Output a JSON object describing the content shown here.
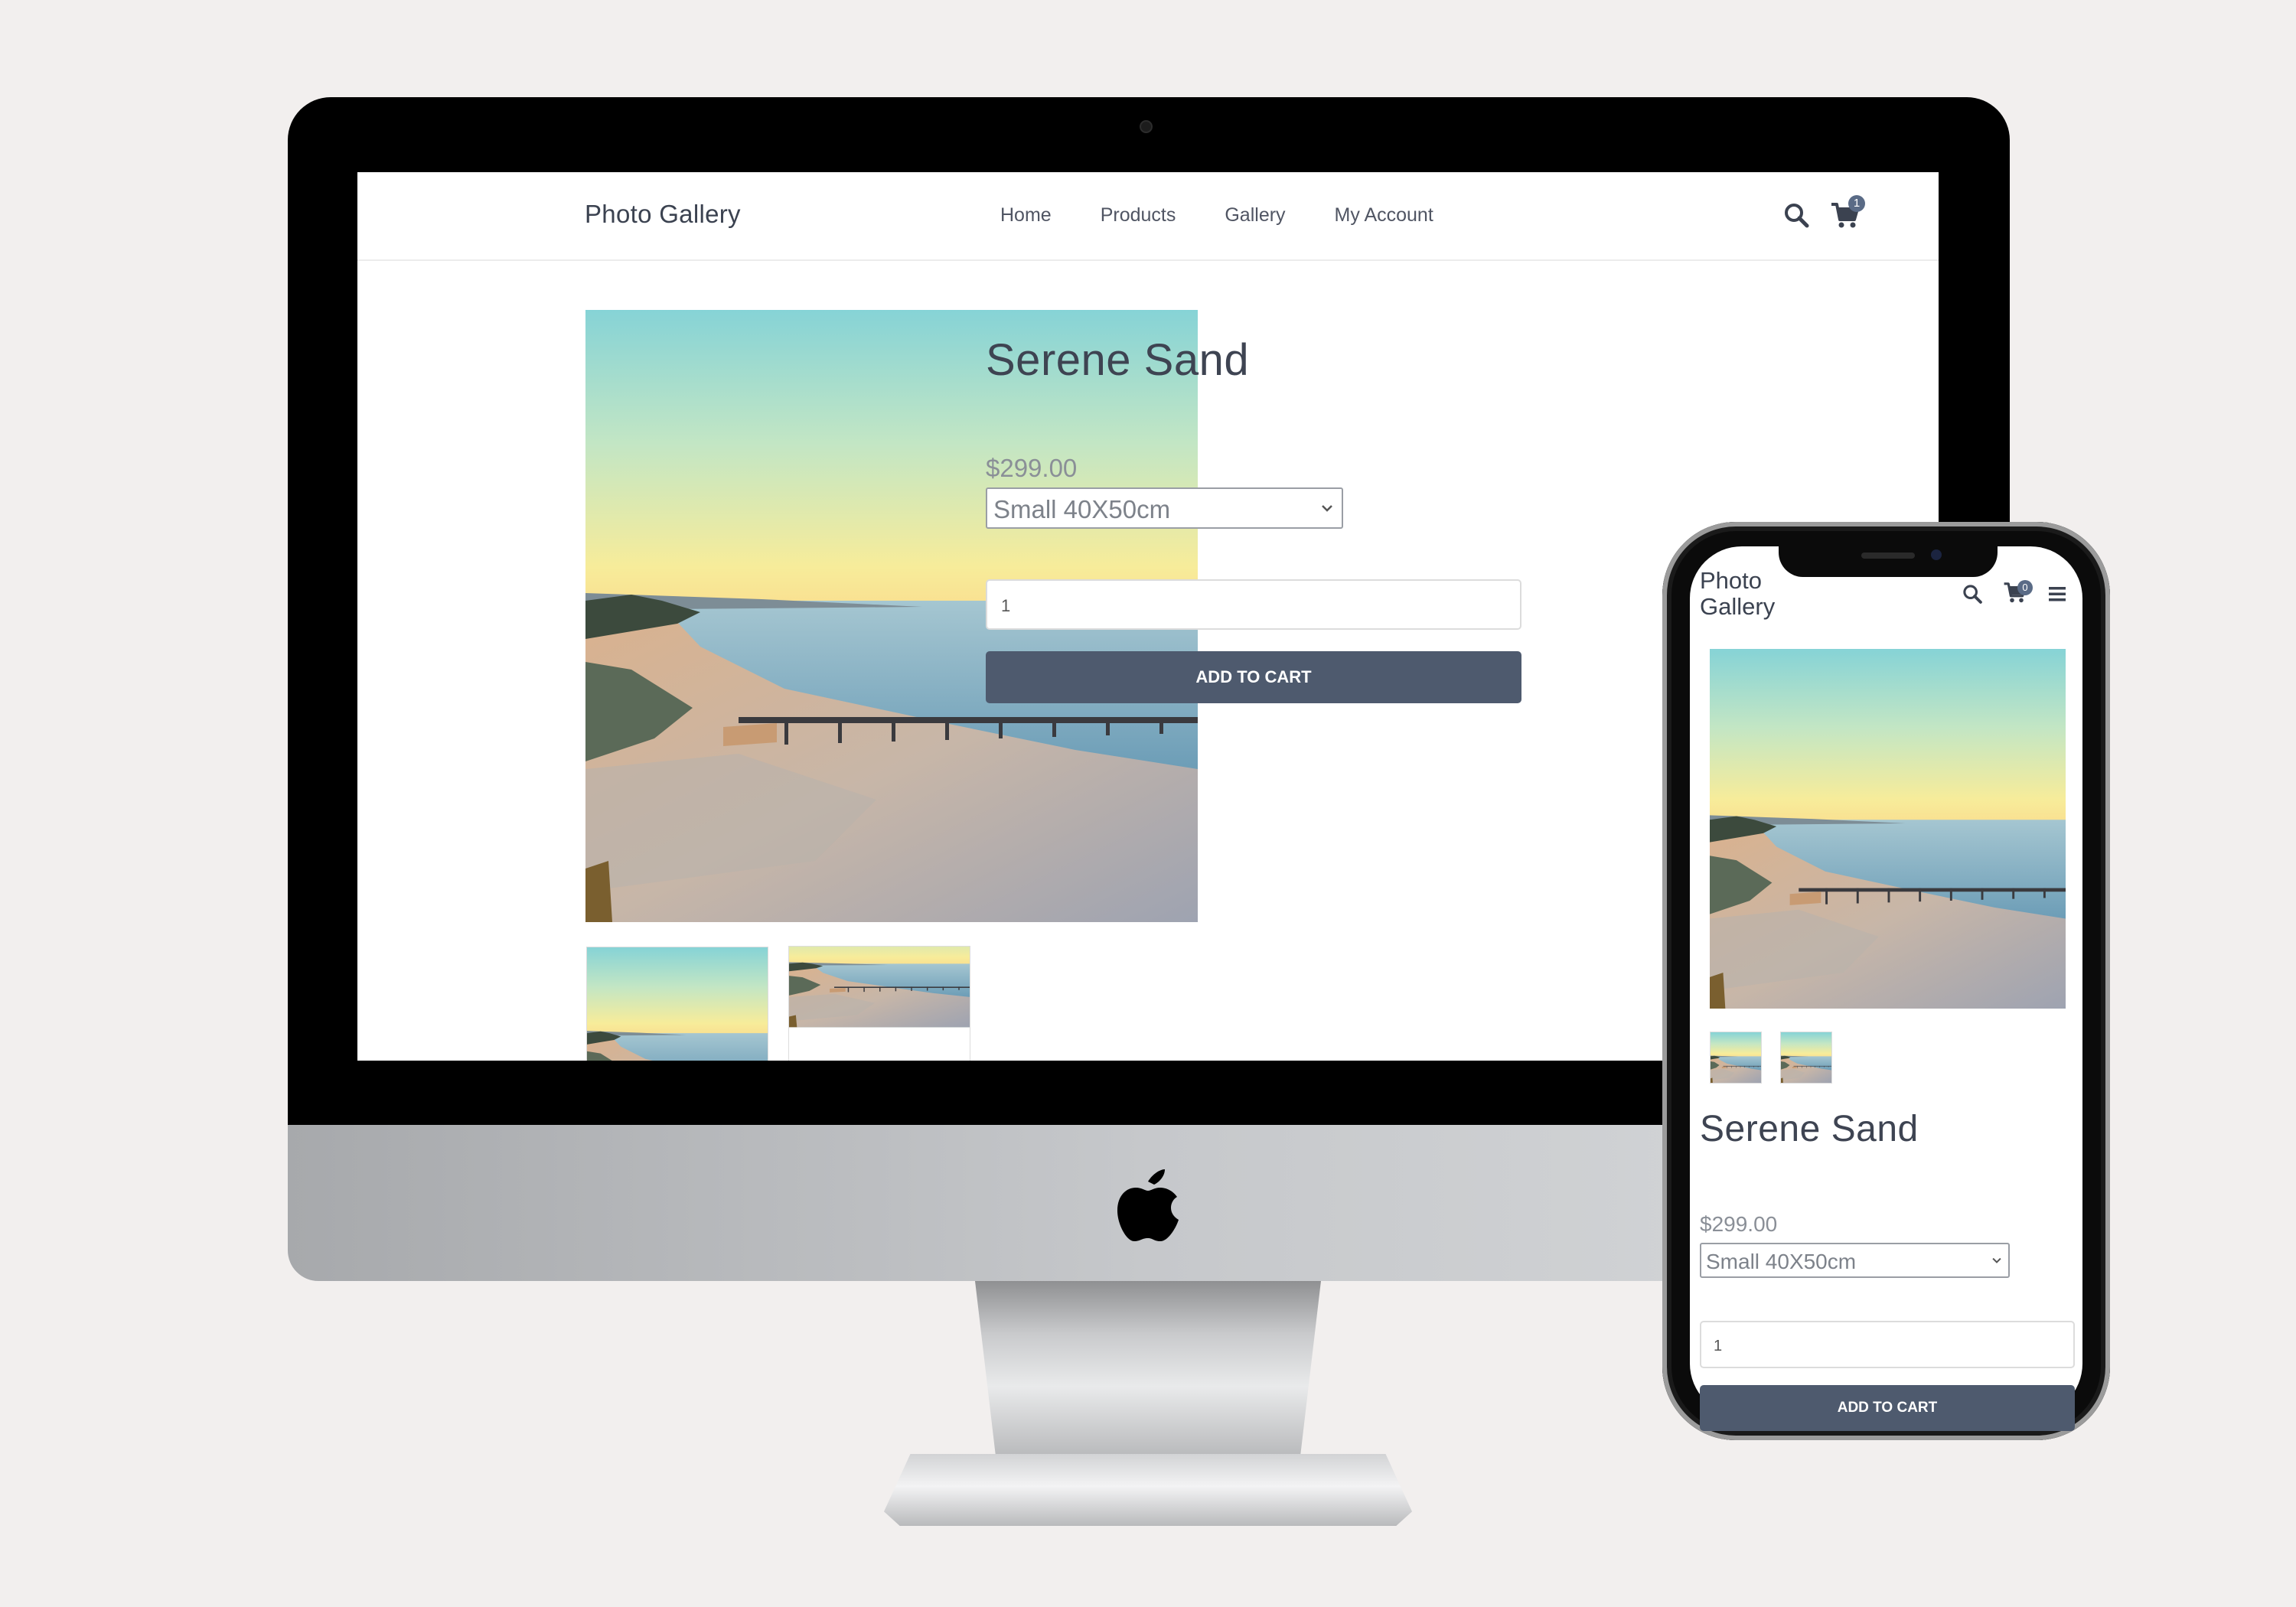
{
  "desktop": {
    "brand": "Photo Gallery",
    "nav": [
      "Home",
      "Products",
      "Gallery",
      "My Account"
    ],
    "cart_count": "1",
    "product": {
      "title": "Serene Sand",
      "price": "$299.00",
      "size_option": "Small 40X50cm",
      "quantity": "1",
      "add_to_cart": "ADD TO CART"
    }
  },
  "mobile": {
    "brand_line1": "Photo",
    "brand_line2": "Gallery",
    "cart_count": "0",
    "product": {
      "title": "Serene Sand",
      "price": "$299.00",
      "size_option": "Small 40X50cm",
      "quantity": "1",
      "add_to_cart": "ADD TO CART"
    }
  },
  "icons": {
    "search": "search-icon",
    "cart": "cart-icon",
    "menu": "hamburger-menu-icon",
    "chevron": "chevron-down-icon",
    "apple": "apple-logo-icon"
  },
  "colors": {
    "button": "#4e5a6e",
    "badge": "#5a6b86",
    "text_dark": "#3e4452",
    "price": "#8a8f97",
    "background": "#f2efee"
  }
}
